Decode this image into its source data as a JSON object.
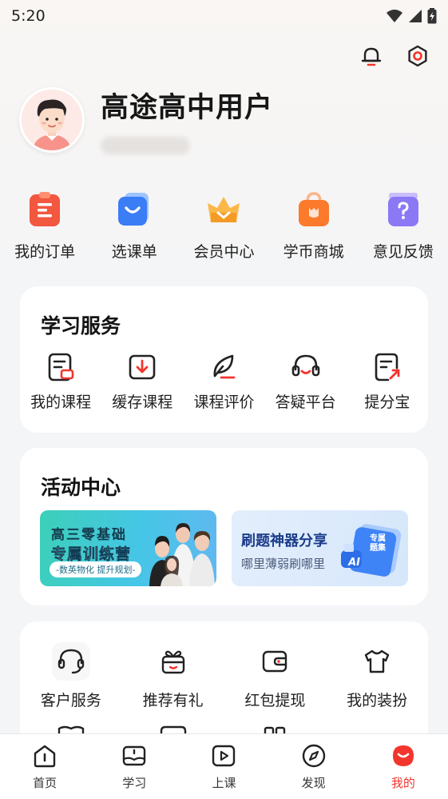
{
  "status_bar": {
    "time": "5:20"
  },
  "profile": {
    "username": "高途高中用户"
  },
  "quick_actions": [
    {
      "label": "我的订单",
      "icon": "order-icon"
    },
    {
      "label": "选课单",
      "icon": "cart-icon"
    },
    {
      "label": "会员中心",
      "icon": "crown-icon"
    },
    {
      "label": "学币商城",
      "icon": "shop-bag-icon"
    },
    {
      "label": "意见反馈",
      "icon": "feedback-icon"
    }
  ],
  "learning_services": {
    "title": "学习服务",
    "items": [
      {
        "label": "我的课程",
        "icon": "course-icon"
      },
      {
        "label": "缓存课程",
        "icon": "download-icon"
      },
      {
        "label": "课程评价",
        "icon": "review-icon"
      },
      {
        "label": "答疑平台",
        "icon": "headset-icon"
      },
      {
        "label": "提分宝",
        "icon": "score-up-icon"
      }
    ]
  },
  "activity_center": {
    "title": "活动中心",
    "banner_left": {
      "line1": "高三零基础",
      "line2": "专属训练营",
      "tag": "-数英物化 提升规划-"
    },
    "banner_right": {
      "title": "刷题神器分享",
      "subtitle": "哪里薄弱刷哪里",
      "badge": "AI",
      "book_label": "专属题集"
    }
  },
  "more_services": [
    {
      "label": "客户服务",
      "icon": "customer-service-icon"
    },
    {
      "label": "推荐有礼",
      "icon": "gift-icon"
    },
    {
      "label": "红包提现",
      "icon": "wallet-icon"
    },
    {
      "label": "我的装扮",
      "icon": "tshirt-icon"
    }
  ],
  "tab_bar": [
    {
      "label": "首页",
      "icon": "home-icon",
      "active": false
    },
    {
      "label": "学习",
      "icon": "study-icon",
      "active": false
    },
    {
      "label": "上课",
      "icon": "play-icon",
      "active": false
    },
    {
      "label": "发现",
      "icon": "compass-icon",
      "active": false
    },
    {
      "label": "我的",
      "icon": "profile-icon",
      "active": true
    }
  ],
  "colors": {
    "accent": "#f2362e",
    "background": "#f4f5f7"
  }
}
